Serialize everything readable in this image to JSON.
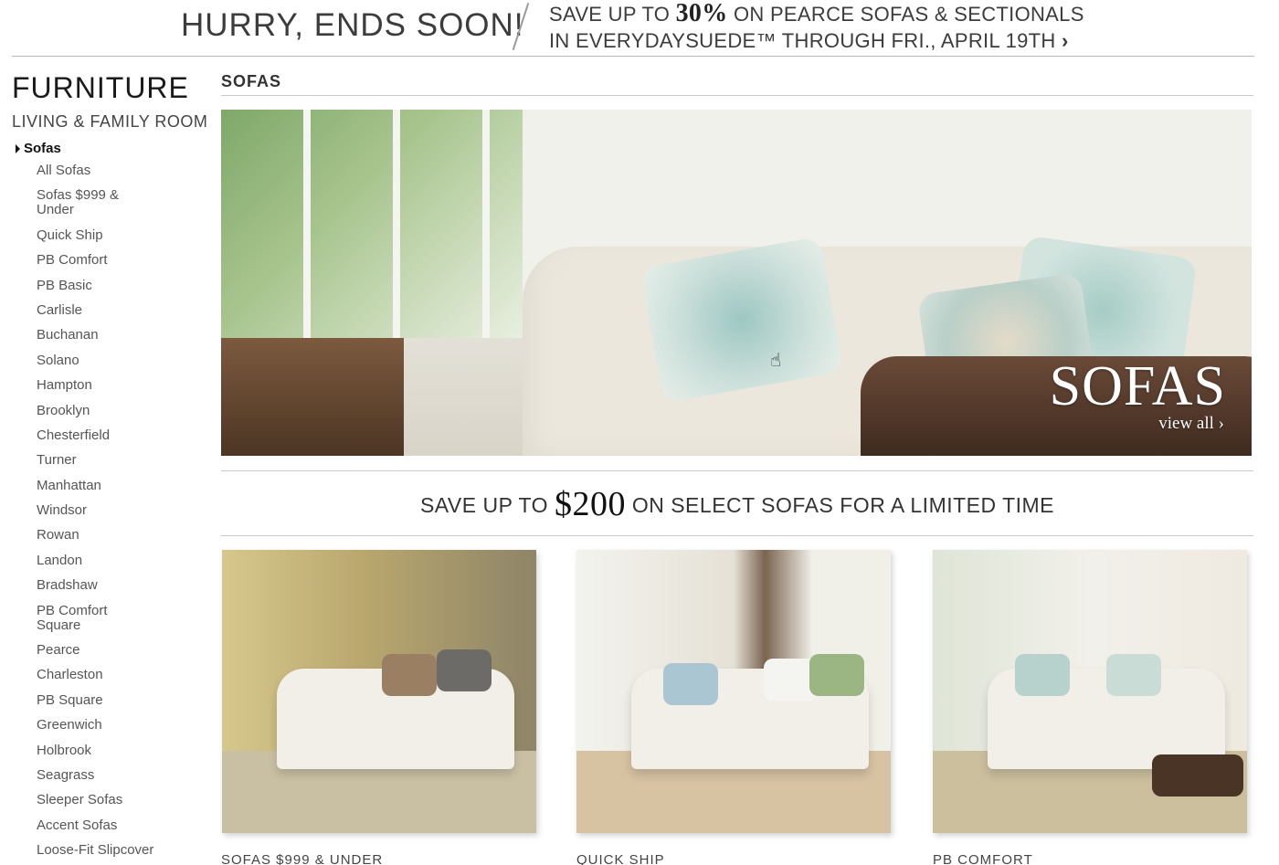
{
  "promo": {
    "left": "HURRY, ENDS SOON!",
    "line1_a": "SAVE UP TO ",
    "line1_big": "30%",
    "line1_b": " ON PEARCE SOFAS & SECTIONALS",
    "line2": "IN EVERYDAYSUEDE™ THROUGH FRI., APRIL 19TH",
    "chevron": "›"
  },
  "sidebar": {
    "title": "FURNITURE",
    "subtitle": "LIVING & FAMILY ROOM",
    "active": "Sofas",
    "items": [
      "All Sofas",
      "Sofas $999 & Under",
      "Quick Ship",
      "PB Comfort",
      "PB Basic",
      "Carlisle",
      "Buchanan",
      "Solano",
      "Hampton",
      "Brooklyn",
      "Chesterfield",
      "Turner",
      "Manhattan",
      "Windsor",
      "Rowan",
      "Landon",
      "Bradshaw",
      "PB Comfort Square",
      "Pearce",
      "Charleston",
      "PB Square",
      "Greenwich",
      "Holbrook",
      "Seagrass",
      "Sleeper Sofas",
      "Accent Sofas",
      "Loose-Fit Slipcover"
    ]
  },
  "main": {
    "section_title": "SOFAS",
    "hero": {
      "brand": "SOFAS",
      "link": "view all ›"
    },
    "promo2": {
      "a": "SAVE UP TO ",
      "big": "$200",
      "b": " ON SELECT SOFAS FOR A LIMITED TIME"
    },
    "cards": [
      {
        "label": "SOFAS $999 & UNDER"
      },
      {
        "label": "QUICK SHIP"
      },
      {
        "label": "PB COMFORT"
      }
    ]
  },
  "cursor_glyph": "☝"
}
